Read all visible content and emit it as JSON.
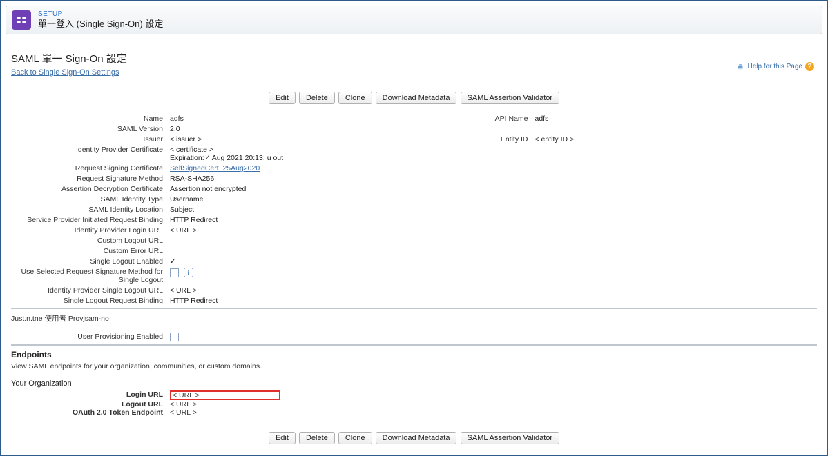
{
  "header": {
    "setup_label": "SETUP",
    "title": "單一登入 (Single Sign-On) 設定"
  },
  "page": {
    "title": "SAML 單一 Sign-On 設定",
    "back_link": "Back to Single Sign-On Settings",
    "help_link": "Help for this Page"
  },
  "buttons": {
    "edit": "Edit",
    "delete": "Delete",
    "clone": "Clone",
    "download_metadata": "Download Metadata",
    "saml_assertion_validator": "SAML Assertion Validator"
  },
  "fields": {
    "name": {
      "label": "Name",
      "value": "adfs"
    },
    "api_name": {
      "label": "API Name",
      "value": "adfs"
    },
    "saml_version": {
      "label": "SAML Version",
      "value": "2.0"
    },
    "issuer": {
      "label": "Issuer",
      "value": "< issuer >"
    },
    "entity_id": {
      "label": "Entity ID",
      "value": "< entity ID >"
    },
    "idp_cert": {
      "label": "Identity Provider Certificate",
      "value": "< certificate >",
      "exp": "Expiration: 4 Aug 2021 20:13: u out"
    },
    "req_sign_cert": {
      "label": "Request Signing Certificate",
      "value": "SelfSignedCert_25Aug2020"
    },
    "req_sig_method": {
      "label": "Request Signature Method",
      "value": "RSA-SHA256"
    },
    "assert_decrypt_cert": {
      "label": "Assertion Decryption Certificate",
      "value": "Assertion not encrypted"
    },
    "saml_id_type": {
      "label": "SAML Identity Type",
      "value": "Username"
    },
    "saml_id_loc": {
      "label": "SAML Identity Location",
      "value": "Subject"
    },
    "sp_binding": {
      "label": "Service Provider Initiated Request Binding",
      "value": "HTTP Redirect"
    },
    "idp_login_url": {
      "label": "Identity Provider Login URL",
      "value": "< URL >"
    },
    "custom_logout_url": {
      "label": "Custom Logout URL",
      "value": ""
    },
    "custom_error_url": {
      "label": "Custom Error URL",
      "value": ""
    },
    "single_logout_enabled": {
      "label": "Single Logout Enabled",
      "value": "✓"
    },
    "use_selected_sig": {
      "label": "Use Selected Request Signature Method for Single Logout"
    },
    "idp_slo_url": {
      "label": "Identity Provider Single Logout URL",
      "value": "< URL >"
    },
    "slo_binding": {
      "label": "Single Logout Request Binding",
      "value": "HTTP Redirect"
    }
  },
  "provisioning": {
    "section": "Just.n.tne 使用者 Provjsam-no",
    "enabled_label": "User Provisioning Enabled"
  },
  "endpoints": {
    "heading": "Endpoints",
    "desc": "View SAML endpoints for your organization, communities, or custom domains.",
    "org_heading": "Your Organization",
    "login_url": {
      "label": "Login URL",
      "value": "< URL >"
    },
    "logout_url": {
      "label": "Logout URL",
      "value": "< URL >"
    },
    "oauth_endpoint": {
      "label": "OAuth 2.0 Token Endpoint",
      "value": "< URL >"
    }
  }
}
